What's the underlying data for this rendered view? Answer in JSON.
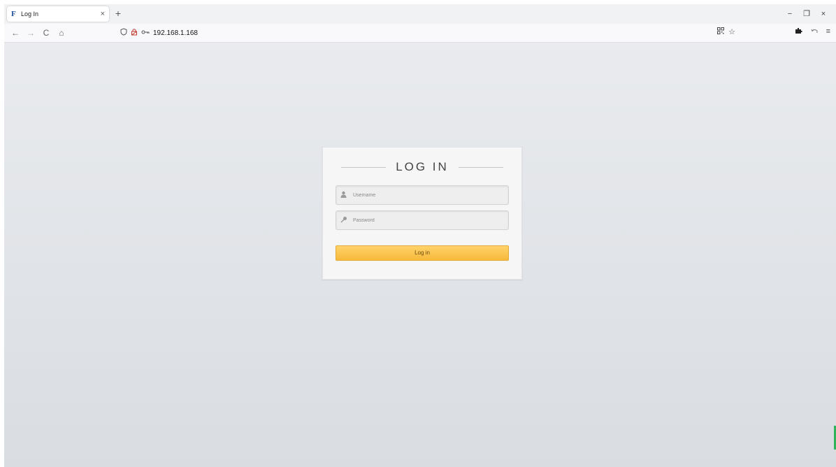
{
  "browser": {
    "tab": {
      "favicon": "F",
      "title": "Log In",
      "close": "×"
    },
    "new_tab": "+",
    "window_controls": {
      "minimize": "−",
      "restore": "❐",
      "close": "×"
    },
    "nav": {
      "back": "←",
      "forward": "→",
      "reload": "C",
      "home": "⌂"
    },
    "url": "192.168.1.168",
    "url_icons": {
      "shield": "shield-icon",
      "lock": "lock-icon",
      "key": "key-icon"
    },
    "url_right": {
      "qr": "qr-code-icon",
      "bookmark": "star-icon"
    },
    "toolbar_right": {
      "extensions": "puzzle-icon",
      "undo": "undo-icon",
      "menu": "menu-icon"
    }
  },
  "login": {
    "title": "LOG IN",
    "username_placeholder": "Username",
    "password_placeholder": "Password",
    "submit_label": "Log in"
  },
  "colors": {
    "button_top": "#ffd36b",
    "button_bottom": "#f7b93a",
    "page_bg": "#e3e6ea"
  }
}
